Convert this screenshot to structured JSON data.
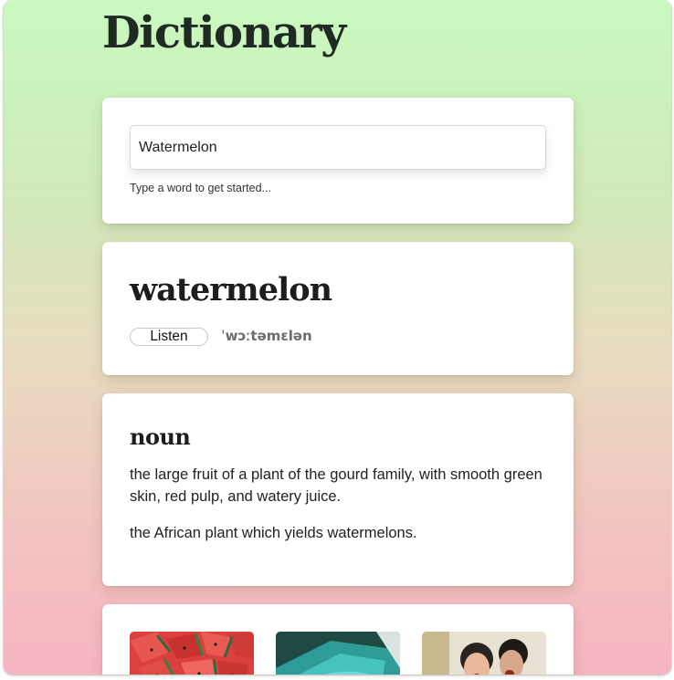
{
  "app": {
    "title": "Dictionary"
  },
  "search": {
    "value": "Watermelon",
    "hint": "Type a word to get started..."
  },
  "entry": {
    "word": "watermelon",
    "listen_label": "Listen",
    "phonetic": "ˈwɔːtəmɛlən"
  },
  "meanings": [
    {
      "part_of_speech": "noun",
      "definitions": [
        "the large fruit of a plant of the gourd family, with smooth green skin, red pulp, and watery juice.",
        "the African plant which yields watermelons."
      ]
    }
  ],
  "images": [
    {
      "name": "watermelon-slices-image"
    },
    {
      "name": "watermelon-rind-image"
    },
    {
      "name": "people-eating-image"
    }
  ],
  "colors": {
    "gradient_top": "#c9f9bf",
    "gradient_bottom": "#f7b4c2",
    "card_background": "#ffffff",
    "title_text": "#1f2a24",
    "phonetic_text": "#6c6c6c"
  }
}
